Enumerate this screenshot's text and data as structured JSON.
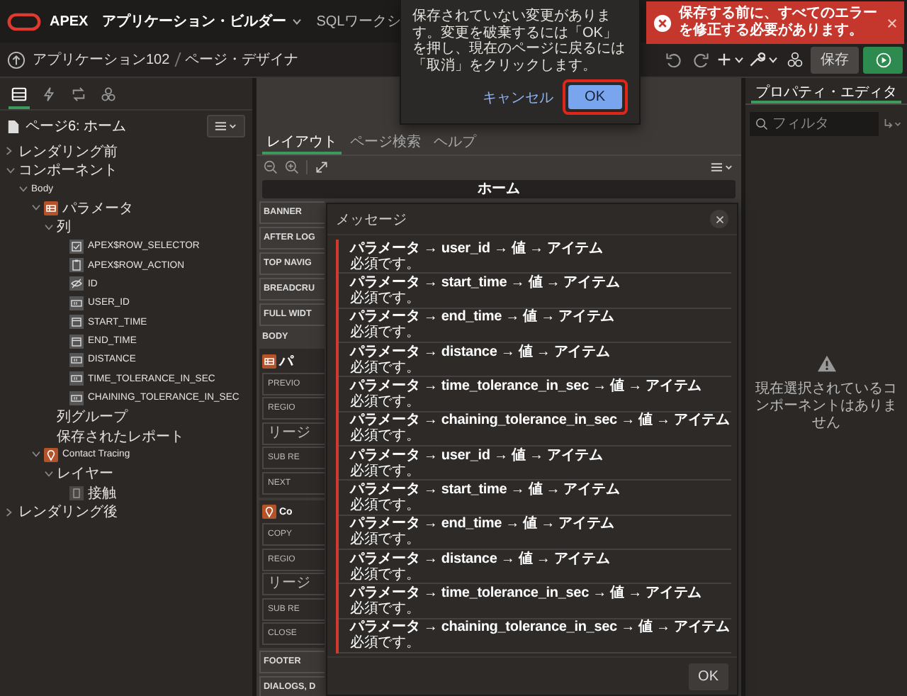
{
  "header": {
    "logo": "APEX",
    "menus": [
      {
        "label": "アプリケーション・ビルダー",
        "dropdown": true
      },
      {
        "label": "SQLワークシ",
        "dropdown": false
      }
    ]
  },
  "confirm_dialog": {
    "message": "保存されていない変更があります。変更を破棄するには「OK」を押し、現在のページに戻るには「取消」をクリックします。",
    "buttons": [
      {
        "label": "キャンセル",
        "kind": "link",
        "highlighted": false
      },
      {
        "label": "OK",
        "kind": "primary",
        "highlighted": true
      }
    ]
  },
  "error_toast": {
    "message": "保存する前に、すべてのエラーを修正する必要があります。"
  },
  "breadcrumb": [
    "アプリケーション102",
    "ページ・デザイナ"
  ],
  "toolbar": [
    {
      "kind": "undo"
    },
    {
      "kind": "redo"
    },
    {
      "kind": "add",
      "dropdown": true
    },
    {
      "kind": "utilities",
      "dropdown": true
    },
    {
      "kind": "shared"
    },
    {
      "kind": "save",
      "label": "保存"
    },
    {
      "kind": "run"
    }
  ],
  "left_pane": {
    "tabs": [
      {
        "selected": true
      },
      {
        "selected": false
      },
      {
        "selected": false
      },
      {
        "selected": false
      }
    ],
    "page_title": "ページ6: ホーム",
    "tree": [
      {
        "label": "レンダリング前",
        "expanded": false
      },
      {
        "label": "コンポーネント",
        "expanded": true,
        "children": [
          {
            "label": "Body",
            "expanded": true,
            "children": [
              {
                "label": "パラメータ",
                "kind": "grid_region",
                "expanded": true,
                "children": [
                  {
                    "label": "列",
                    "expanded": true,
                    "children": [
                      {
                        "label": "APEX$ROW_SELECTOR",
                        "kind": "checkbox_column"
                      },
                      {
                        "label": "APEX$ROW_ACTION",
                        "kind": "action_column"
                      },
                      {
                        "label": "ID",
                        "kind": "hidden_column"
                      },
                      {
                        "label": "USER_ID",
                        "kind": "number_column"
                      },
                      {
                        "label": "START_TIME",
                        "kind": "date_column"
                      },
                      {
                        "label": "END_TIME",
                        "kind": "date_column"
                      },
                      {
                        "label": "DISTANCE",
                        "kind": "number_column"
                      },
                      {
                        "label": "TIME_TOLERANCE_IN_SEC",
                        "kind": "number_column"
                      },
                      {
                        "label": "CHAINING_TOLERANCE_IN_SEC",
                        "kind": "number_column"
                      }
                    ]
                  },
                  {
                    "label": "列グループ"
                  },
                  {
                    "label": "保存されたレポート"
                  }
                ]
              },
              {
                "label": "Contact Tracing",
                "kind": "map_region",
                "expanded": true,
                "children": [
                  {
                    "label": "レイヤー",
                    "expanded": true,
                    "children": [
                      {
                        "label": "接触",
                        "kind": "layer"
                      }
                    ]
                  }
                ]
              }
            ]
          }
        ]
      },
      {
        "label": "レンダリング後",
        "expanded": false
      }
    ]
  },
  "center_pane": {
    "tabs": [
      {
        "label": "レイアウト",
        "selected": true
      },
      {
        "label": "ページ検索",
        "selected": false
      },
      {
        "label": "ヘルプ",
        "selected": false
      }
    ],
    "page_bar": "ホーム",
    "slots": [
      {
        "kind": "position",
        "label": "BANNER"
      },
      {
        "kind": "position",
        "label": "AFTER LOG"
      },
      {
        "kind": "position",
        "label": "TOP NAVIG"
      },
      {
        "kind": "position",
        "label": "BREADCRU"
      },
      {
        "kind": "position",
        "label": "FULL WIDT"
      },
      {
        "kind": "heading",
        "label": "BODY"
      },
      {
        "kind": "grid_region",
        "title": "パ",
        "buttons": [
          "PREVIO",
          "REGIO",
          "リージ",
          "SUB RE",
          "NEXT"
        ]
      },
      {
        "kind": "map_region",
        "title": "Co",
        "buttons": [
          "COPY",
          "REGIO",
          "リージ",
          "SUB RE",
          "CLOSE"
        ]
      },
      {
        "kind": "position",
        "label": "FOOTER"
      },
      {
        "kind": "position",
        "label": "DIALOGS, D"
      }
    ]
  },
  "message_dialog": {
    "title": "メッセージ",
    "messages": [
      {
        "path": "パラメータ → user_id → 値 → アイテム",
        "text": "必須です。"
      },
      {
        "path": "パラメータ → start_time → 値 → アイテム",
        "text": "必須です。"
      },
      {
        "path": "パラメータ → end_time → 値 → アイテム",
        "text": "必須です。"
      },
      {
        "path": "パラメータ → distance → 値 → アイテム",
        "text": "必須です。"
      },
      {
        "path": "パラメータ → time_tolerance_in_sec → 値 → アイテム",
        "text": "必須です。"
      },
      {
        "path": "パラメータ → chaining_tolerance_in_sec → 値 → アイテム",
        "text": "必須です。"
      },
      {
        "path": "パラメータ → user_id → 値 → アイテム",
        "text": "必須です。"
      },
      {
        "path": "パラメータ → start_time → 値 → アイテム",
        "text": "必須です。"
      },
      {
        "path": "パラメータ → end_time → 値 → アイテム",
        "text": "必須です。"
      },
      {
        "path": "パラメータ → distance → 値 → アイテム",
        "text": "必須です。"
      },
      {
        "path": "パラメータ → time_tolerance_in_sec → 値 → アイテム",
        "text": "必須です。"
      },
      {
        "path": "パラメータ → chaining_tolerance_in_sec → 値 → アイテム",
        "text": "必須です。"
      }
    ],
    "button": "OK"
  },
  "right_pane": {
    "tabs": [
      {
        "label": "プロパティ・エディタ",
        "selected": true
      }
    ],
    "filter": {
      "placeholder": "フィルタ"
    },
    "empty_message": "現在選択されているコンポーネントはありません"
  }
}
